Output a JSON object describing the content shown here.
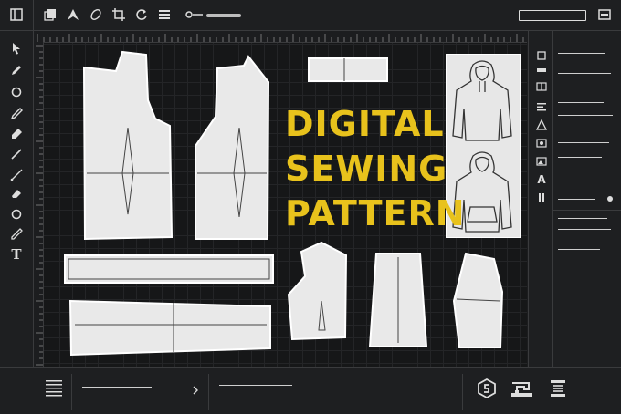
{
  "title_lines": [
    "DIGITAL",
    "SEWING",
    "PATTERN"
  ],
  "colors": {
    "accent": "#e8c21c",
    "piece_fill": "#e9e9e9",
    "background": "#161718"
  },
  "top_toolbar_icons": [
    "sidebar-toggle-icon",
    "layers-icon",
    "pen-tool-icon",
    "eraser-icon",
    "crop-icon",
    "rotate-icon",
    "menu-icon",
    "brush-slider-icon",
    "window-icon"
  ],
  "left_tools": [
    "select-arrow-icon",
    "pencil-icon",
    "circle-icon",
    "pen-icon",
    "marker-icon",
    "line-icon",
    "diagonal-line-icon",
    "eraser-icon",
    "ellipse-icon",
    "needle-icon",
    "text-tool-icon"
  ],
  "left_tool_text": "T",
  "right_panel_icons": [
    "panel-square-icon",
    "panel-rectangle-icon",
    "panel-split-icon",
    "align-icon",
    "triangle-icon",
    "image-icon",
    "picture-icon",
    "font-icon",
    "column-icon"
  ],
  "right_panel_font_letter": "A",
  "bottom_icons": [
    "list-icon",
    "brand-logo-icon",
    "sewing-machine-icon",
    "spool-icon"
  ]
}
